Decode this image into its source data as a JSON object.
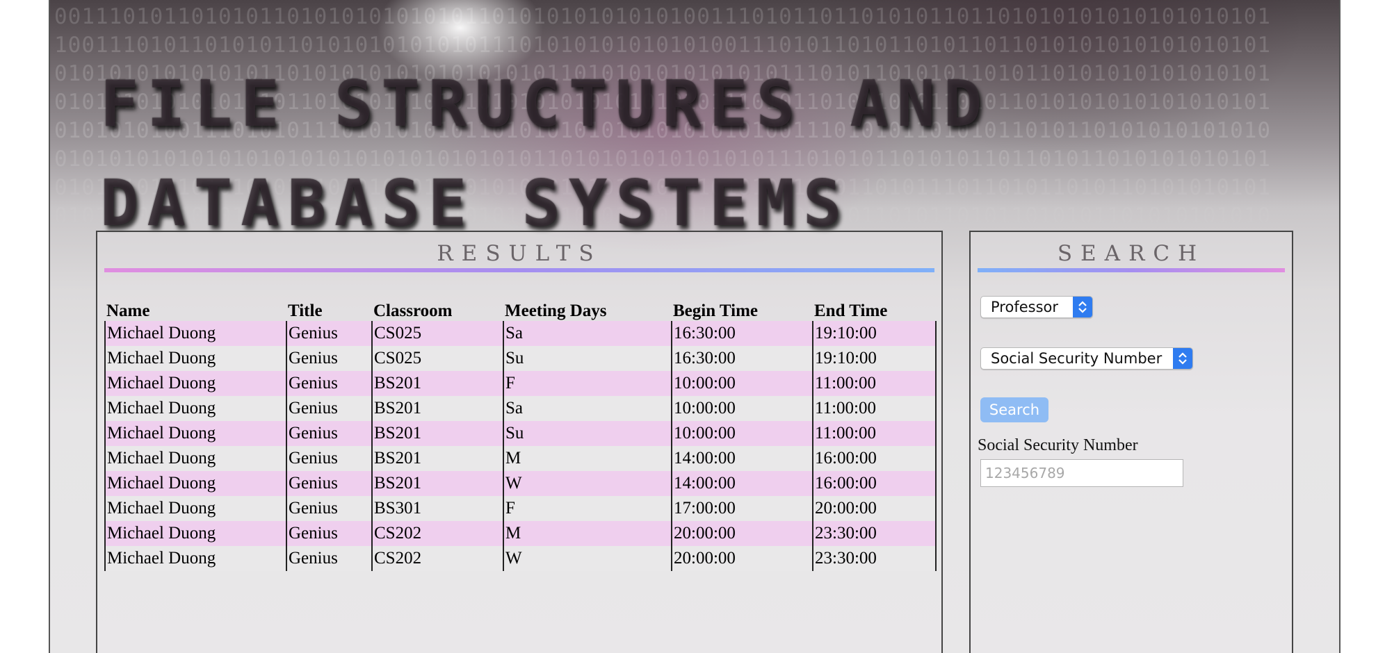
{
  "site": {
    "title_line1": "FILE STRUCTURES AND",
    "title_line2": "DATABASE SYSTEMS",
    "background_binary": [
      "00111010110101011010101010101011010101010101010011101011011010101101101010101010101010101",
      "10011101011010101101010101010101110101010101010100111010110101101011011010101010101010101",
      "01010101010101011010101010101010101011010101010101010111010110101011010110101010101010101",
      "01010101010101010110101010101010101010101010101011101011010110101101011010101010101010101",
      "01010101001110101011101010101011010101010101010101010011101010110101011010110101010101010",
      "01010101010101010101010101010101010110101010101010101110101011010101101101011010101010101",
      "01010101010101010101010101010101010101010101010101010110101101011101101011010110101010101",
      "01010101010101010101010101010101010101010101010101010101010110101101011010101101010101010"
    ]
  },
  "results": {
    "heading": "RESULTS",
    "columns": [
      "Name",
      "Title",
      "Classroom",
      "Meeting Days",
      "Begin Time",
      "End Time"
    ],
    "rows": [
      [
        "Michael Duong",
        "Genius",
        "CS025",
        "Sa",
        "16:30:00",
        "19:10:00"
      ],
      [
        "Michael Duong",
        "Genius",
        "CS025",
        "Su",
        "16:30:00",
        "19:10:00"
      ],
      [
        "Michael Duong",
        "Genius",
        "BS201",
        "F",
        "10:00:00",
        "11:00:00"
      ],
      [
        "Michael Duong",
        "Genius",
        "BS201",
        "Sa",
        "10:00:00",
        "11:00:00"
      ],
      [
        "Michael Duong",
        "Genius",
        "BS201",
        "Su",
        "10:00:00",
        "11:00:00"
      ],
      [
        "Michael Duong",
        "Genius",
        "BS201",
        "M",
        "14:00:00",
        "16:00:00"
      ],
      [
        "Michael Duong",
        "Genius",
        "BS201",
        "W",
        "14:00:00",
        "16:00:00"
      ],
      [
        "Michael Duong",
        "Genius",
        "BS301",
        "F",
        "17:00:00",
        "20:00:00"
      ],
      [
        "Michael Duong",
        "Genius",
        "CS202",
        "M",
        "20:00:00",
        "23:30:00"
      ],
      [
        "Michael Duong",
        "Genius",
        "CS202",
        "W",
        "20:00:00",
        "23:30:00"
      ]
    ]
  },
  "search": {
    "heading": "SEARCH",
    "type_select_value": "Professor",
    "field_select_value": "Social Security Number",
    "button_label": "Search",
    "field_label": "Social Security Number",
    "input_value": "",
    "input_placeholder": "123456789"
  },
  "colors": {
    "row_odd": "#efcfee",
    "row_even": "#e9e8e9",
    "search_button": "#8fbcf4",
    "select_arrow": "#2f7cf0",
    "divider_pink": "#e08ee0",
    "divider_blue": "#7fb0f8"
  },
  "icons": {
    "select_arrow": "up-down-chevron-icon"
  }
}
